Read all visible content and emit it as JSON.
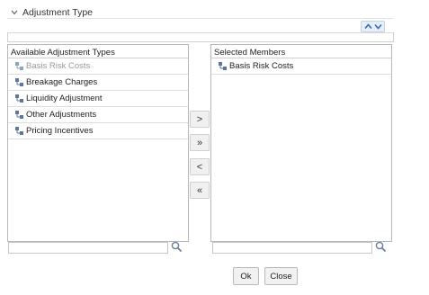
{
  "header": {
    "title": "Adjustment Type"
  },
  "available": {
    "title": "Available Adjustment Types",
    "items": [
      {
        "label": "Basis Risk Costs",
        "disabled": true
      },
      {
        "label": "Breakage Charges",
        "disabled": false
      },
      {
        "label": "Liquidity Adjustment",
        "disabled": false
      },
      {
        "label": "Other Adjustments",
        "disabled": false
      },
      {
        "label": "Pricing Incentives",
        "disabled": false
      }
    ],
    "search_value": ""
  },
  "selected": {
    "title": "Selected Members",
    "items": [
      {
        "label": "Basis Risk Costs"
      }
    ],
    "search_value": ""
  },
  "shuttle": {
    "move": ">",
    "move_all": "»",
    "remove": "<",
    "remove_all": "«"
  },
  "footer": {
    "ok_label": "Ok",
    "close_label": "Close"
  },
  "icons": {
    "header_toggle": "chevron-down-icon",
    "sort_up": "chevron-up-icon",
    "sort_down": "chevron-down-icon",
    "member": "hierarchy-member-icon",
    "search": "magnifier-icon"
  },
  "colors": {
    "accent": "#3b6db3",
    "disabled_text": "#9a9a9a"
  }
}
